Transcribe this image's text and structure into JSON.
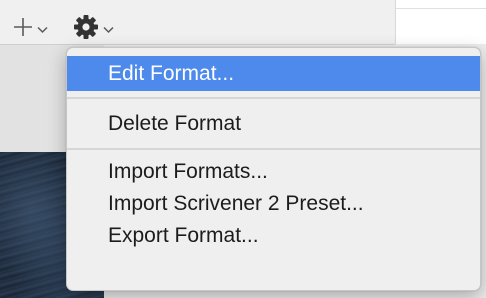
{
  "toolbar": {
    "add_icon": "plus-icon",
    "settings_icon": "gear-icon",
    "dropdown_icon": "chevron-down-icon"
  },
  "menu": {
    "edit_format": "Edit Format...",
    "delete_format": "Delete Format",
    "import_formats": "Import Formats...",
    "import_scrivener_preset": "Import Scrivener 2 Preset...",
    "export_format": "Export Format..."
  },
  "colors": {
    "highlight": "#4d8aeb",
    "menu_background": "#efefef"
  }
}
